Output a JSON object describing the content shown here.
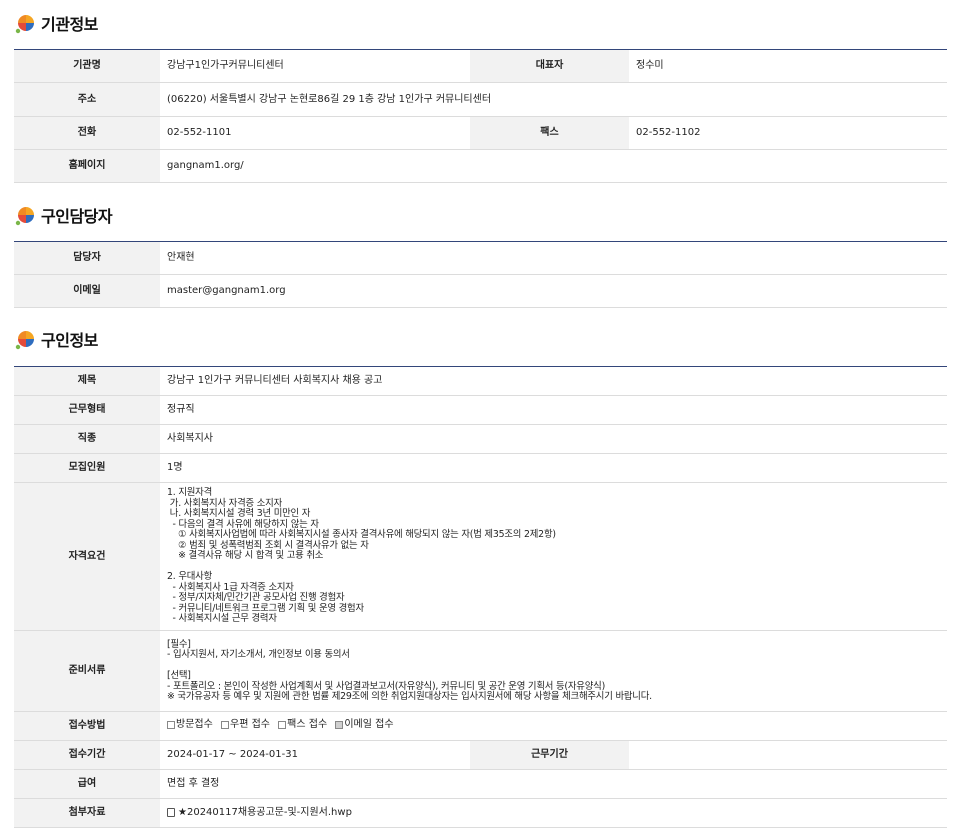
{
  "sections": {
    "institution": "기관정보",
    "recruiter": "구인담당자",
    "job": "구인정보"
  },
  "institution": {
    "name_label": "기관명",
    "name": "강남구1인가구커뮤니티센터",
    "rep_label": "대표자",
    "rep": "정수미",
    "address_label": "주소",
    "address": "(06220) 서울특별시 강남구 논현로86길 29 1층 강남 1인가구 커뮤니티센터",
    "phone_label": "전화",
    "phone": "02-552-1101",
    "fax_label": "팩스",
    "fax": "02-552-1102",
    "homepage_label": "홈페이지",
    "homepage": "gangnam1.org/"
  },
  "recruiter": {
    "manager_label": "담당자",
    "manager": "안재현",
    "email_label": "이메일",
    "email": "master@gangnam1.org"
  },
  "job": {
    "title_label": "제목",
    "title": "강남구 1인가구 커뮤니티센터 사회복지사 채용 공고",
    "emp_type_label": "근무형태",
    "emp_type": "정규직",
    "occupation_label": "직종",
    "occupation": "사회복지사",
    "headcount_label": "모집인원",
    "headcount": "1명",
    "qual_label": "자격요건",
    "qualifications": "1. 지원자격\n 가. 사회복지사 자격증 소지자\n 나. 사회복지시설 경력 3년 미만인 자\n  - 다음의 결격 사유에 해당하지 않는 자\n    ① 사회복지사업법에 따라 사회복지시설 종사자 결격사유에 해당되지 않는 자(법 제35조의 2제2항)\n    ② 범죄 및 성폭력범죄 조회 시 결격사유가 없는 자\n    ※ 결격사유 해당 시 합격 및 고용 취소\n\n2. 우대사항\n  - 사회복지사 1급 자격증 소지자\n  - 정부/지자체/민간기관 공모사업 진행 경험자\n  - 커뮤니티/네트워크 프로그램 기획 및 운영 경험자\n  - 사회복지시설 근무 경력자",
    "docs_label": "준비서류",
    "documents": "[필수]\n- 입사지원서, 자기소개서, 개인정보 이용 동의서\n\n[선택]\n- 포트폴리오 : 본인이 작성한 사업계획서 및 사업결과보고서(자유양식), 커뮤니티 및 공간 운영 기획서 등(자유양식)\n※ 국가유공자 등 예우 및 지원에 관한 법률 제29조에 의한 취업지원대상자는 입사지원서에 해당 사항을 체크해주시기 바랍니다.",
    "method_label": "접수방법",
    "methods": [
      {
        "label": "방문접수",
        "checked": false
      },
      {
        "label": "우편 접수",
        "checked": false
      },
      {
        "label": "팩스 접수",
        "checked": false
      },
      {
        "label": "이메일 접수",
        "checked": true
      }
    ],
    "period_label": "접수기간",
    "period": "2024-01-17 ~ 2024-01-31",
    "work_period_label": "근무기간",
    "work_period": "",
    "salary_label": "급여",
    "salary": "면접 후 결정",
    "attach_label": "첨부자료",
    "attachment": "★20240117채용공고문-및-지원서.hwp"
  }
}
